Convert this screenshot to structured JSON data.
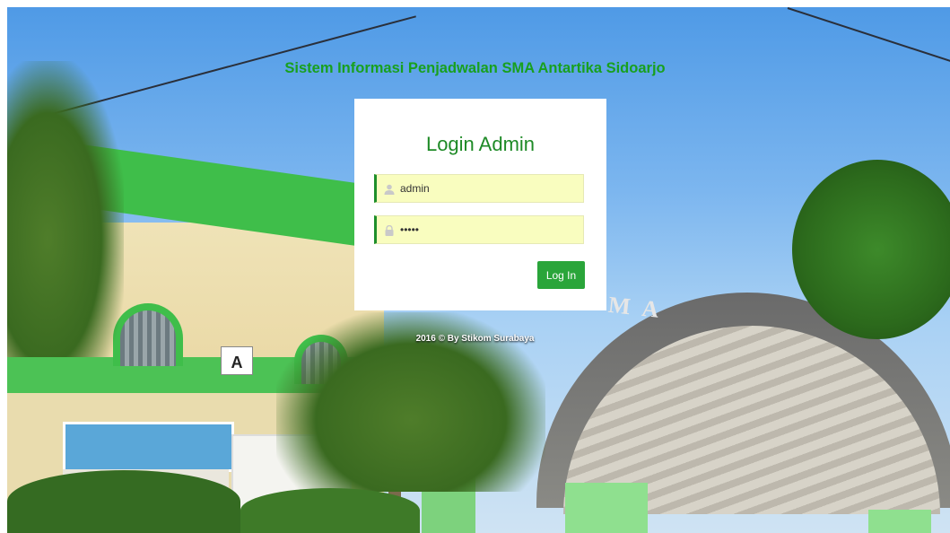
{
  "page": {
    "title": "Sistem Informasi Penjadwalan SMA Antartika Sidoarjo",
    "footer": "2016 © By Stikom Surabaya"
  },
  "login": {
    "heading": "Login Admin",
    "username_value": "admin",
    "password_value": "admin",
    "button_label": "Log In"
  },
  "background": {
    "building_label": "A",
    "canopy_text": "M A",
    "icons": [
      "user-icon",
      "lock-icon"
    ]
  },
  "colors": {
    "accent": "#1e8f2b",
    "title": "#18a01e",
    "button": "#2aa53a",
    "field_bg": "#f9fdbf"
  }
}
